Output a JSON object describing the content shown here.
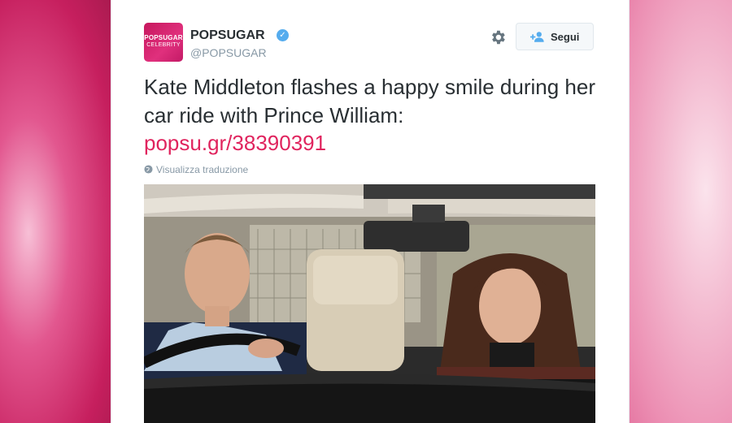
{
  "author": {
    "avatar_line1": "POPSUGAR",
    "avatar_line2": "CELEBRITY",
    "name": "POPSUGAR",
    "handle": "@POPSUGAR",
    "verified": true
  },
  "actions": {
    "settings_icon": "gear-icon",
    "follow_label": "Segui",
    "follow_icon": "person-plus-icon"
  },
  "tweet": {
    "text": "Kate Middleton flashes a happy smile during her car ride with Prince William:",
    "link": "popsu.gr/38390391",
    "translate_label": "Visualizza traduzione"
  },
  "colors": {
    "brand": "#c6175d",
    "link": "#e0245e",
    "verified": "#55acee"
  }
}
